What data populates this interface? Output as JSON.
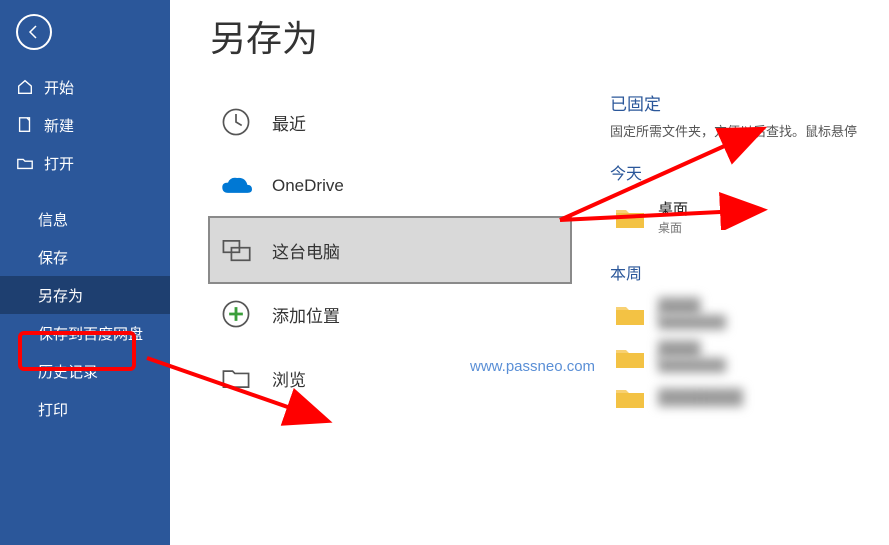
{
  "page_title": "另存为",
  "sidebar_top": [
    {
      "key": "home",
      "label": "开始"
    },
    {
      "key": "new",
      "label": "新建"
    },
    {
      "key": "open",
      "label": "打开"
    }
  ],
  "sidebar_sub": [
    {
      "key": "info",
      "label": "信息"
    },
    {
      "key": "save",
      "label": "保存"
    },
    {
      "key": "saveas",
      "label": "另存为",
      "selected": true
    },
    {
      "key": "baidu",
      "label": "保存到百度网盘"
    },
    {
      "key": "history",
      "label": "历史记录"
    },
    {
      "key": "print",
      "label": "打印"
    }
  ],
  "locations": [
    {
      "key": "recent",
      "label": "最近"
    },
    {
      "key": "onedrive",
      "label": "OneDrive"
    },
    {
      "key": "thispc",
      "label": "这台电脑",
      "selected": true
    },
    {
      "key": "addloc",
      "label": "添加位置"
    },
    {
      "key": "browse",
      "label": "浏览"
    }
  ],
  "pinned": {
    "title": "已固定",
    "desc": "固定所需文件夹，方便以后查找。鼠标悬停"
  },
  "groups": [
    {
      "head": "今天",
      "folders": [
        {
          "name": "桌面",
          "path": "桌面",
          "blur": false
        }
      ]
    },
    {
      "head": "本周",
      "folders": [
        {
          "name": "████",
          "path": "████████",
          "blur": true
        },
        {
          "name": "████",
          "path": "████████",
          "blur": true
        },
        {
          "name": "████████",
          "path": "",
          "blur": true
        }
      ]
    }
  ],
  "watermark": "www.passneo.com",
  "colors": {
    "brand": "#2b579a",
    "annotation": "#ff0000"
  }
}
